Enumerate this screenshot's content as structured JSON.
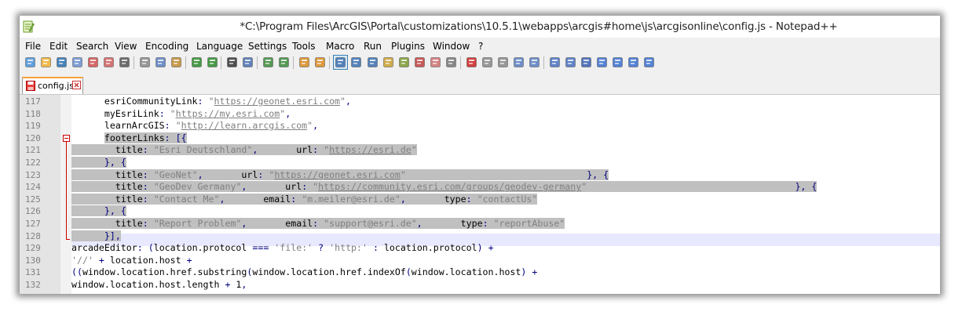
{
  "window": {
    "title": "*C:\\Program Files\\ArcGIS\\Portal\\customizations\\10.5.1\\webapps\\arcgis#home\\js\\arcgisonline\\config.js - Notepad++"
  },
  "menu": [
    "File",
    "Edit",
    "Search",
    "View",
    "Encoding",
    "Language",
    "Settings",
    "Tools",
    "Macro",
    "Run",
    "Plugins",
    "Window",
    "?"
  ],
  "toolbar_icons": [
    "new-file-icon",
    "open-file-icon",
    "save-icon",
    "save-all-icon",
    "close-icon",
    "close-all-icon",
    "print-icon",
    "cut-icon",
    "copy-icon",
    "paste-icon",
    "undo-icon",
    "redo-icon",
    "find-icon",
    "replace-icon",
    "zoom-in-icon",
    "zoom-out-icon",
    "sync-vertical-icon",
    "sync-horizontal-icon",
    "word-wrap-icon",
    "show-all-characters-icon",
    "indent-guide-icon",
    "user-defined-language-icon",
    "document-map-icon",
    "function-list-icon",
    "folder-as-workspace-icon",
    "monitoring-icon",
    "record-macro-icon",
    "stop-macro-icon",
    "play-macro-icon",
    "run-macro-multiple-icon",
    "save-macro-icon",
    "compare-icon",
    "clear-results-icon",
    "navigate-icon",
    "up-icon",
    "down-icon",
    "first-icon",
    "settings-icon"
  ],
  "tab": {
    "label": "config.js"
  },
  "colors": {
    "selection": "#c0c0c0",
    "current_line": "#e8e8ff",
    "string": "#808080",
    "operator": "#000080",
    "gutter": "#e4e4e4",
    "fold_marker": "#cc0000",
    "tab_accent": "#f9a23b"
  },
  "lines": [
    {
      "n": "117",
      "text": "      esriCommunityLink: \"https://geonet.esri.com\","
    },
    {
      "n": "118",
      "text": "      myEsriLink: \"https://my.esri.com\","
    },
    {
      "n": "119",
      "text": "      learnArcGIS: \"http://learn.arcgis.com\","
    },
    {
      "n": "120",
      "text": "      footerLinks: [{"
    },
    {
      "n": "121",
      "text": "        title: \"Esri Deutschland\",       url: \"https://esri.de\""
    },
    {
      "n": "122",
      "text": "      }, {"
    },
    {
      "n": "123",
      "text": "        title: \"GeoNet\",       url: \"https://geonet.esri.com\"                                 }, {"
    },
    {
      "n": "124",
      "text": "        title: \"GeoDev Germany\",       url: \"https://community.esri.com/groups/geodev-germany\"                                      }, {"
    },
    {
      "n": "125",
      "text": "        title: \"Contact Me\",       email: \"m.meiler@esri.de\",       type: \"contactUs\""
    },
    {
      "n": "126",
      "text": "      }, {"
    },
    {
      "n": "127",
      "text": "        title: \"Report Problem\",       email: \"support@esri.de\",       type: \"reportAbuse\""
    },
    {
      "n": "128",
      "text": "      }],"
    },
    {
      "n": "129",
      "text": "arcadeEditor: (location.protocol === 'file:' ? 'http:' : location.protocol) +"
    },
    {
      "n": "130",
      "text": "'//' + location.host +"
    },
    {
      "n": "131",
      "text": "((window.location.href.substring(window.location.href.indexOf(window.location.host) +"
    },
    {
      "n": "132",
      "text": "window.location.host.length + 1,"
    }
  ]
}
